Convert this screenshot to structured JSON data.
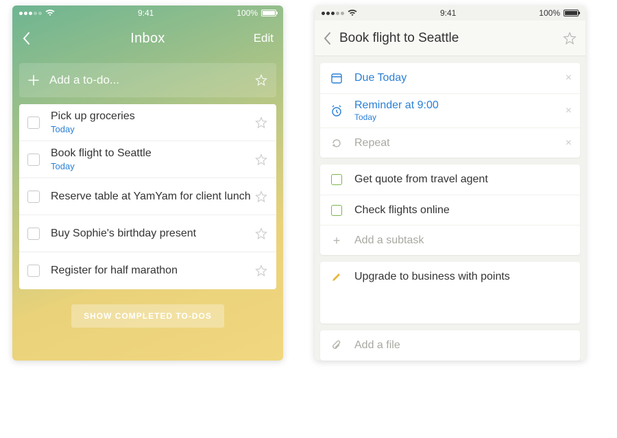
{
  "status": {
    "time": "9:41",
    "battery_pct": "100%"
  },
  "left": {
    "nav": {
      "title": "Inbox",
      "edit": "Edit"
    },
    "add": {
      "placeholder": "Add a to-do..."
    },
    "todos": [
      {
        "title": "Pick up groceries",
        "sub": "Today"
      },
      {
        "title": "Book flight to Seattle",
        "sub": "Today"
      },
      {
        "title": "Reserve table at YamYam for client lunch",
        "sub": ""
      },
      {
        "title": "Buy Sophie's birthday present",
        "sub": ""
      },
      {
        "title": "Register for half marathon",
        "sub": ""
      }
    ],
    "show_completed": "SHOW COMPLETED TO-DOS"
  },
  "right": {
    "nav": {
      "title": "Book flight to Seattle"
    },
    "meta": {
      "due": "Due Today",
      "reminder_title": "Reminder at 9:00",
      "reminder_sub": "Today",
      "repeat": "Repeat"
    },
    "subtasks": [
      "Get quote from travel agent",
      "Check flights online"
    ],
    "add_subtask": "Add a subtask",
    "note": "Upgrade to business with points",
    "add_file": "Add a file"
  }
}
